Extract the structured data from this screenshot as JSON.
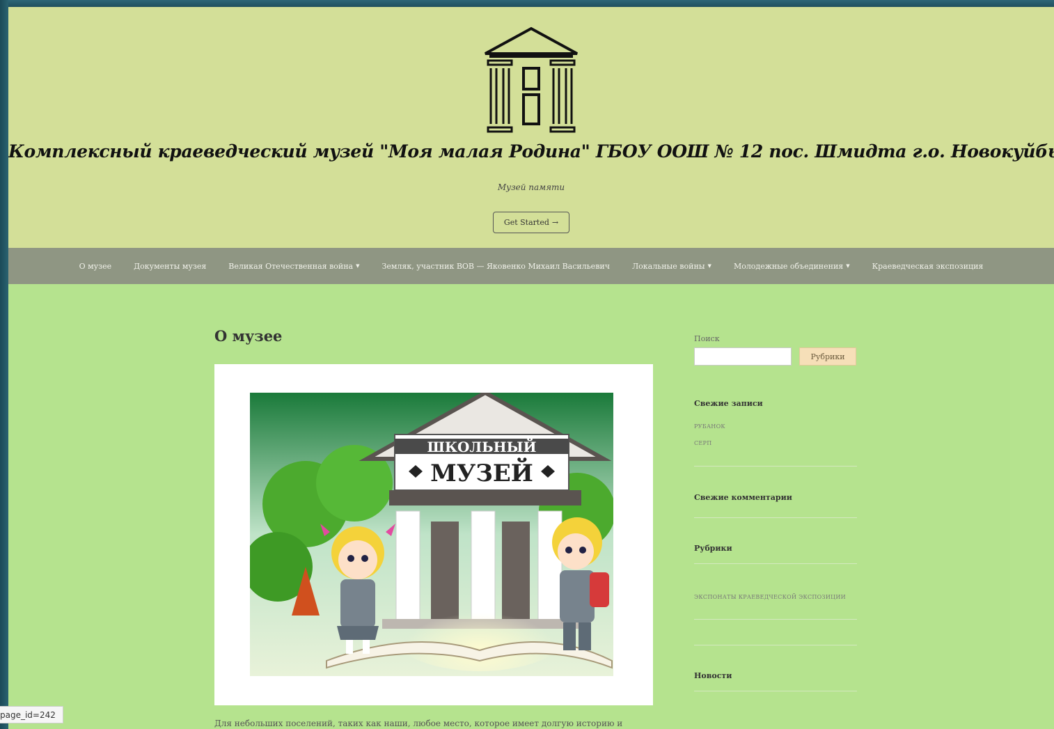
{
  "url_tip": "page_id=242",
  "header": {
    "site_title": "Комплексный краеведческий музей \"Моя малая Родина\" ГБОУ ООШ № 12 пос. Шмидта г.о. Новокуйбышевск",
    "tagline": "Музей памяти",
    "cta_label": "Get Started"
  },
  "nav": {
    "items": [
      {
        "label": "О музее"
      },
      {
        "label": "Документы музея"
      },
      {
        "label": "Великая Отечественная война"
      },
      {
        "label": "Земляк, участник ВОВ — Яковенко Михаил Васильевич"
      },
      {
        "label": "Локальные войны"
      },
      {
        "label": "Молодежные объединения"
      },
      {
        "label": "Краеведческая экспозиция"
      }
    ]
  },
  "content": {
    "title": "О музее",
    "image_text": {
      "line1": "ШКОЛЬНЫЙ",
      "line2": "МУЗЕЙ"
    },
    "paragraph": "Для небольших поселений, таких как наши, любое место, которое имеет долгую историю и"
  },
  "sidebar": {
    "search_label": "Поиск",
    "search_value": "",
    "search_button": "Рубрики",
    "recent_posts_title": "Свежие записи",
    "recent_posts": [
      "РУБАНОК",
      "СЕРП"
    ],
    "recent_comments_title": "Свежие комментарии",
    "categories_title": "Рубрики",
    "categories": [
      "ЭКСПОНАТЫ КРАЕВЕДЧЕСКОЙ ЭКСПОЗИЦИИ"
    ],
    "news_title": "Новости"
  },
  "colors": {
    "header_bg": "#d3df98",
    "nav_bg": "#8f9683",
    "page_bg": "#b5e38e",
    "search_button_bg": "#f6dfb8"
  }
}
